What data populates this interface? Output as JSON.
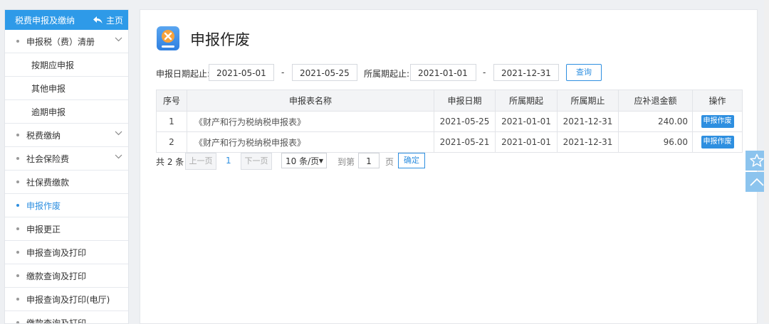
{
  "sidebar": {
    "header_title": "税费申报及缴纳",
    "home_label": "主页",
    "items": [
      {
        "label": "申报税（费）清册",
        "type": "parent",
        "expandable": true
      },
      {
        "label": "按期应申报",
        "type": "sub"
      },
      {
        "label": "其他申报",
        "type": "sub"
      },
      {
        "label": "逾期申报",
        "type": "sub"
      },
      {
        "label": "税费缴纳",
        "type": "parent",
        "expandable": true
      },
      {
        "label": "社会保险费",
        "type": "parent",
        "expandable": true
      },
      {
        "label": "社保费缴款",
        "type": "parent"
      },
      {
        "label": "申报作废",
        "type": "parent",
        "active": true
      },
      {
        "label": "申报更正",
        "type": "parent"
      },
      {
        "label": "申报查询及打印",
        "type": "parent"
      },
      {
        "label": "缴款查询及打印",
        "type": "parent"
      },
      {
        "label": "申报查询及打印(电厅)",
        "type": "parent"
      },
      {
        "label": "缴款查询及打印",
        "type": "parent"
      }
    ]
  },
  "page": {
    "title": "申报作废",
    "icon": "cancel-declaration-icon"
  },
  "filters": {
    "declare_date_label": "申报日期起止:",
    "declare_start": "2021-05-01",
    "declare_end": "2021-05-25",
    "period_label": "所属期起止:",
    "period_start": "2021-01-01",
    "period_end": "2021-12-31",
    "separator": "-",
    "query_button": "查询"
  },
  "table": {
    "headers": [
      "序号",
      "申报表名称",
      "申报日期",
      "所属期起",
      "所属期止",
      "应补退金额",
      "操作"
    ],
    "rows": [
      {
        "no": "1",
        "name": "《财产和行为税纳税申报表》",
        "declare_date": "2021-05-25",
        "period_start": "2021-01-01",
        "period_end": "2021-12-31",
        "amount": "240.00",
        "action": "申报作废"
      },
      {
        "no": "2",
        "name": "《财产和行为税纳税申报表》",
        "declare_date": "2021-05-21",
        "period_start": "2021-01-01",
        "period_end": "2021-12-31",
        "amount": "96.00",
        "action": "申报作废"
      }
    ]
  },
  "pager": {
    "total": "共 2 条",
    "prev": "上一页",
    "current_page": "1",
    "next": "下一页",
    "page_size": "10 条/页",
    "goto_label": "到第",
    "goto_value": "1",
    "page_unit": "页",
    "confirm": "确定"
  },
  "floating": {
    "favorite_icon": "star-icon",
    "top_icon": "chevron-up-icon"
  },
  "colors": {
    "accent": "#2e9ae8",
    "header_bg": "#2e9ae8",
    "floating_bg": "#8cc4ee"
  }
}
